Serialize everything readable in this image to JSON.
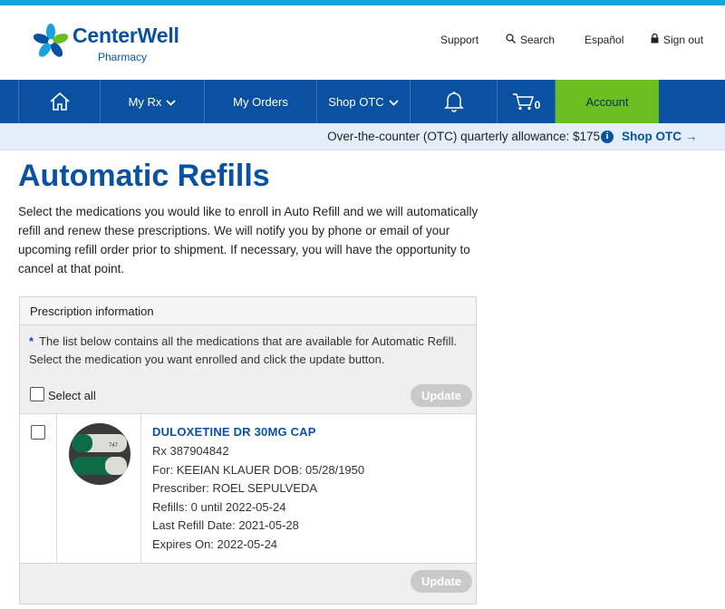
{
  "header": {
    "brand_name": "CenterWell",
    "brand_sub": "Pharmacy",
    "utility": {
      "support": "Support",
      "search": "Search",
      "espanol": "Español",
      "sign_out": "Sign out"
    }
  },
  "nav": {
    "my_rx": "My Rx",
    "my_orders": "My Orders",
    "shop_otc": "Shop OTC",
    "cart_count": "0",
    "account": "Account"
  },
  "banner": {
    "text": "Over-the-counter (OTC) quarterly allowance: $175",
    "info_glyph": "i",
    "link": "Shop OTC →"
  },
  "page": {
    "title": "Automatic Refills",
    "intro": "Select the medications you would like to enroll in Auto Refill and we will automatically refill and renew these prescriptions. We will notify you by phone or email of your upcoming refill order prior to shipment. If necessary, you will have the opportunity to cancel at that point."
  },
  "panel": {
    "heading": "Prescription information",
    "note_star": "*",
    "note": "The list below contains all the medications that are available for Automatic Refill. Select the medication you want enrolled and click the update button.",
    "select_all": "Select all",
    "update_label": "Update",
    "prescription": {
      "name": "DULOXETINE DR 30MG CAP",
      "pill_imprint": "747",
      "rx": "Rx  387904842",
      "for": "For:  KEEIAN KLAUER  DOB: 05/28/1950",
      "prescriber": "Prescriber:  ROEL SEPULVEDA",
      "refills": "Refills: 0  until  2022-05-24",
      "last_refill": "Last Refill Date: 2021-05-28",
      "expires": "Expires On: 2022-05-24"
    }
  },
  "colors": {
    "brand_blue": "#0a51a1",
    "account_green": "#6bbe1f",
    "banner_bg": "#e3eef9"
  }
}
